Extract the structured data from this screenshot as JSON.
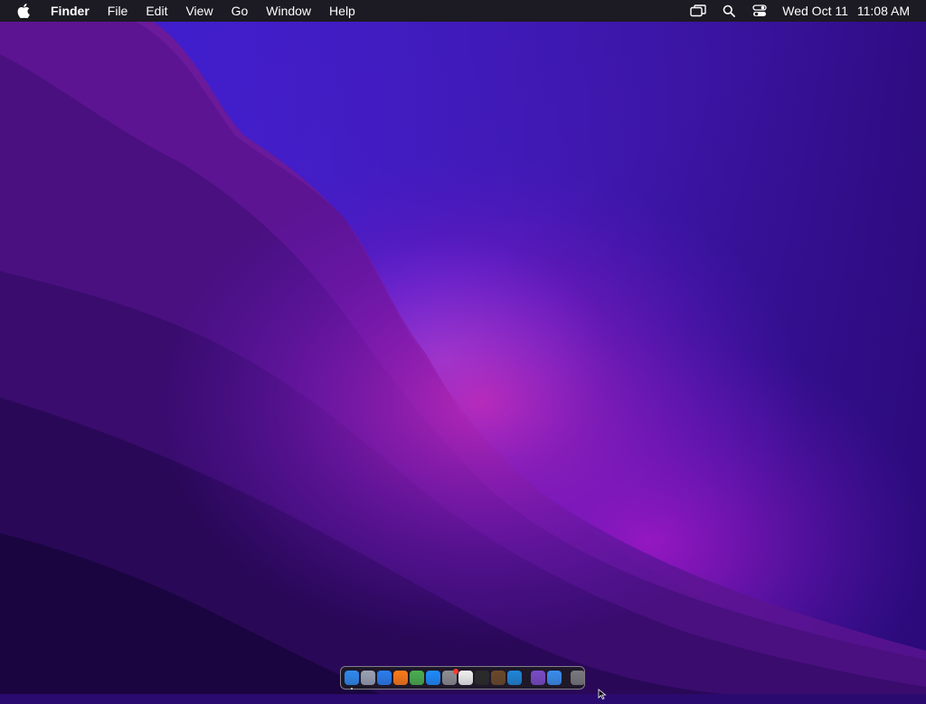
{
  "menubar": {
    "apple_icon": "apple-logo-icon",
    "app_name": "Finder",
    "menus": [
      "File",
      "Edit",
      "View",
      "Go",
      "Window",
      "Help"
    ],
    "status_icons": [
      "screen-mirroring-icon",
      "spotlight-search-icon",
      "control-center-icon"
    ],
    "date": "Wed Oct 11",
    "time": "11:08 AM"
  },
  "dock": {
    "apps": [
      {
        "name": "finder",
        "color": "#2f8bf0",
        "running": true
      },
      {
        "name": "launchpad",
        "color": "#9aa3b5"
      },
      {
        "name": "safari",
        "color": "#2b7df0"
      },
      {
        "name": "firefox",
        "color": "#ff7a1a"
      },
      {
        "name": "chrome",
        "color": "#4caf50"
      },
      {
        "name": "app-store",
        "color": "#1e8cff"
      },
      {
        "name": "system-settings",
        "color": "#8e8e93",
        "badge": true
      },
      {
        "name": "notes-editor",
        "color": "#f2f2f2"
      },
      {
        "name": "terminal",
        "color": "#2b2b2b"
      },
      {
        "name": "script-editor",
        "color": "#6b4a2a"
      },
      {
        "name": "vscode",
        "color": "#1f86d8"
      }
    ],
    "recent_apps": [
      {
        "name": "visual-studio",
        "color": "#7b4cc9"
      },
      {
        "name": "cloud-app",
        "color": "#3a8ef0"
      }
    ],
    "trash": {
      "name": "trash",
      "color": "#7a7a80"
    }
  }
}
